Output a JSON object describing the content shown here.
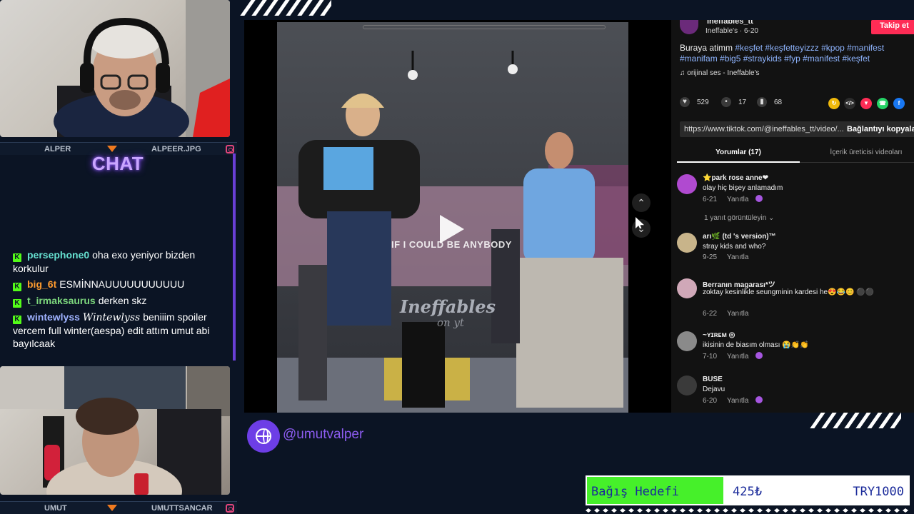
{
  "colors": {
    "background": "#0b1424",
    "chat_title": "#c9a5ff",
    "tiktok_red": "#fe2c55",
    "goal_fill": "#46f02a",
    "handle": "#8c5cf0"
  },
  "webcams": {
    "top": {
      "left_name": "ALPER",
      "right_name": "ALPEER.JPG"
    },
    "bottom": {
      "left_name": "UMUT",
      "right_name": "UMUTTSANCAR"
    }
  },
  "chat": {
    "title": "CHAT",
    "messages": [
      {
        "user": "persephone0",
        "user_color": "#66e0d0",
        "text": "oha exo yeniyor bizden korkulur",
        "emote": ""
      },
      {
        "user": "big_6t",
        "user_color": "#ff9b2e",
        "text": "ESMİNNAUUUUUUUUUUU",
        "emote": ""
      },
      {
        "user": "t_irmaksaurus",
        "user_color": "#7dd87d",
        "text": "derken skz",
        "emote": ""
      },
      {
        "user": "wintewlyss",
        "user_color": "#9fb2ff",
        "text": "beniiim spoiler vercem full winter(aespa) edit attım umut abi bayılcaak",
        "emote": "Wintewlyss"
      }
    ]
  },
  "video": {
    "caption": "IF I COULD BE ANYBODY",
    "watermark": "Ineffables",
    "watermark_sub": "on yt"
  },
  "tiktok": {
    "username": "ineffables_tt",
    "meta": "Ineffable's · 6-20",
    "follow_label": "Takip et",
    "description_prefix": "Buraya atimm",
    "description_tags": "#keşfet #keşfetteyizzz #kpop #manifest #manifam #big5 #straykids #fyp #manifest #keşfet",
    "sound": "♫  orijinal ses - Ineffable's",
    "likes": "529",
    "comments_count": "17",
    "saves": "68",
    "url": "https://www.tiktok.com/@ineffables_tt/video/...",
    "copy_link": "Bağlantıyı kopyala",
    "tab_comments": "Yorumlar (17)",
    "tab_creator_videos": "İçerik üreticisi videoları",
    "view_replies": "1 yanıt görüntüleyin ⌄",
    "reply_label": "Yanıtla",
    "comments": [
      {
        "name": "⭐park rose anne❤",
        "text": "olay hiç bişey anlamadım",
        "date": "6-21",
        "avatar_color": "#b04ad0"
      },
      {
        "name": "arı🌿 (td 's version)™",
        "text": "stray kids and who?",
        "date": "9-25",
        "avatar_color": "#c8b48a"
      },
      {
        "name": "Berranın magarası*ツ",
        "text": "zoktay kesinlikle seungminin kardesi he😍😂😊 ⚫⚫",
        "date": "6-22",
        "avatar_color": "#d0a8b8"
      },
      {
        "name": "~ʏɪʀᴇᴍ ◎",
        "text": "ikisinin de biasım olması 😭👏👏",
        "date": "7-10",
        "avatar_color": "#8a8a8a"
      },
      {
        "name": "BUSE",
        "text": "Dejavu",
        "date": "6-20",
        "avatar_color": "#3a3a3a"
      }
    ]
  },
  "streamer_handle": "@umutvalper",
  "donation_goal": {
    "label": "Bağış Hedefi",
    "current": "425₺",
    "target": "TRY1000",
    "progress": 0.425
  }
}
